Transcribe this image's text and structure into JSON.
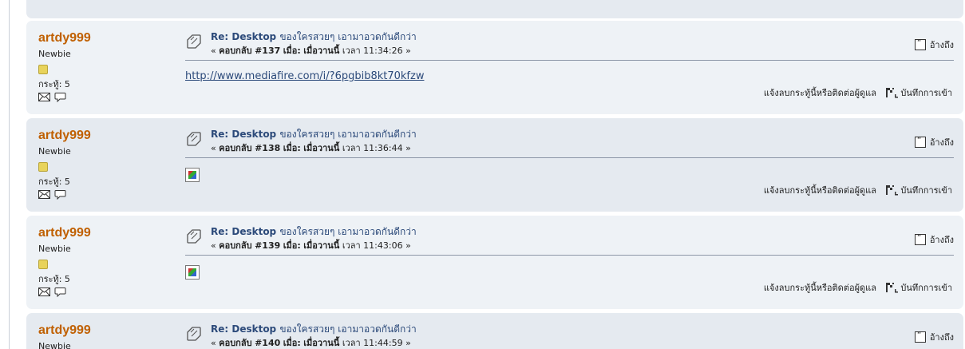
{
  "posts": [
    {
      "poster": {
        "name": "artdy999",
        "rank": "Newbie",
        "posts_label": "กระทู้: 5"
      },
      "subject_en": "Re: Desktop",
      "subject_th": "ของใครสวยๆ เอามาอวดกันดีกว่า",
      "reply_label": "คอบกลับ",
      "reply_num": "#137",
      "when_label": "เมื่อ:",
      "when_value": "เมื่อวานนี้",
      "time_prefix": "เวลา",
      "time": "11:34:26",
      "quote_label": "อ้างถึง",
      "body_link": "http://www.mediafire.com/i/?6pgbib8kt70kfzw",
      "body_image": "",
      "report_label": "แจ้งลบกระทู้นี้หรือติดต่อผู้ดูแล",
      "ip_label": "บันทึกการเข้า"
    },
    {
      "poster": {
        "name": "artdy999",
        "rank": "Newbie",
        "posts_label": "กระทู้: 5"
      },
      "subject_en": "Re: Desktop",
      "subject_th": "ของใครสวยๆ เอามาอวดกันดีกว่า",
      "reply_label": "คอบกลับ",
      "reply_num": "#138",
      "when_label": "เมื่อ:",
      "when_value": "เมื่อวานนี้",
      "time_prefix": "เวลา",
      "time": "11:36:44",
      "quote_label": "อ้างถึง",
      "body_link": "",
      "body_image": "broken-image-icon",
      "report_label": "แจ้งลบกระทู้นี้หรือติดต่อผู้ดูแล",
      "ip_label": "บันทึกการเข้า"
    },
    {
      "poster": {
        "name": "artdy999",
        "rank": "Newbie",
        "posts_label": "กระทู้: 5"
      },
      "subject_en": "Re: Desktop",
      "subject_th": "ของใครสวยๆ เอามาอวดกันดีกว่า",
      "reply_label": "คอบกลับ",
      "reply_num": "#139",
      "when_label": "เมื่อ:",
      "when_value": "เมื่อวานนี้",
      "time_prefix": "เวลา",
      "time": "11:43:06",
      "quote_label": "อ้างถึง",
      "body_link": "",
      "body_image": "broken-image-icon",
      "report_label": "แจ้งลบกระทู้นี้หรือติดต่อผู้ดูแล",
      "ip_label": "บันทึกการเข้า"
    },
    {
      "poster": {
        "name": "artdy999",
        "rank": "Newbie",
        "posts_label": ""
      },
      "subject_en": "Re: Desktop",
      "subject_th": "ของใครสวยๆ เอามาอวดกันดีกว่า",
      "reply_label": "คอบกลับ",
      "reply_num": "#140",
      "when_label": "เมื่อ:",
      "when_value": "เมื่อวานนี้",
      "time_prefix": "เวลา",
      "time": "11:44:59",
      "quote_label": "อ้างถึง",
      "body_link": "",
      "body_image": "",
      "report_label": "",
      "ip_label": ""
    }
  ],
  "colors": {
    "poster_name": "#c06002",
    "subject": "#2c4a7a",
    "post_odd_bg": "#eef2f6",
    "post_even_bg": "#e5eaf0"
  }
}
